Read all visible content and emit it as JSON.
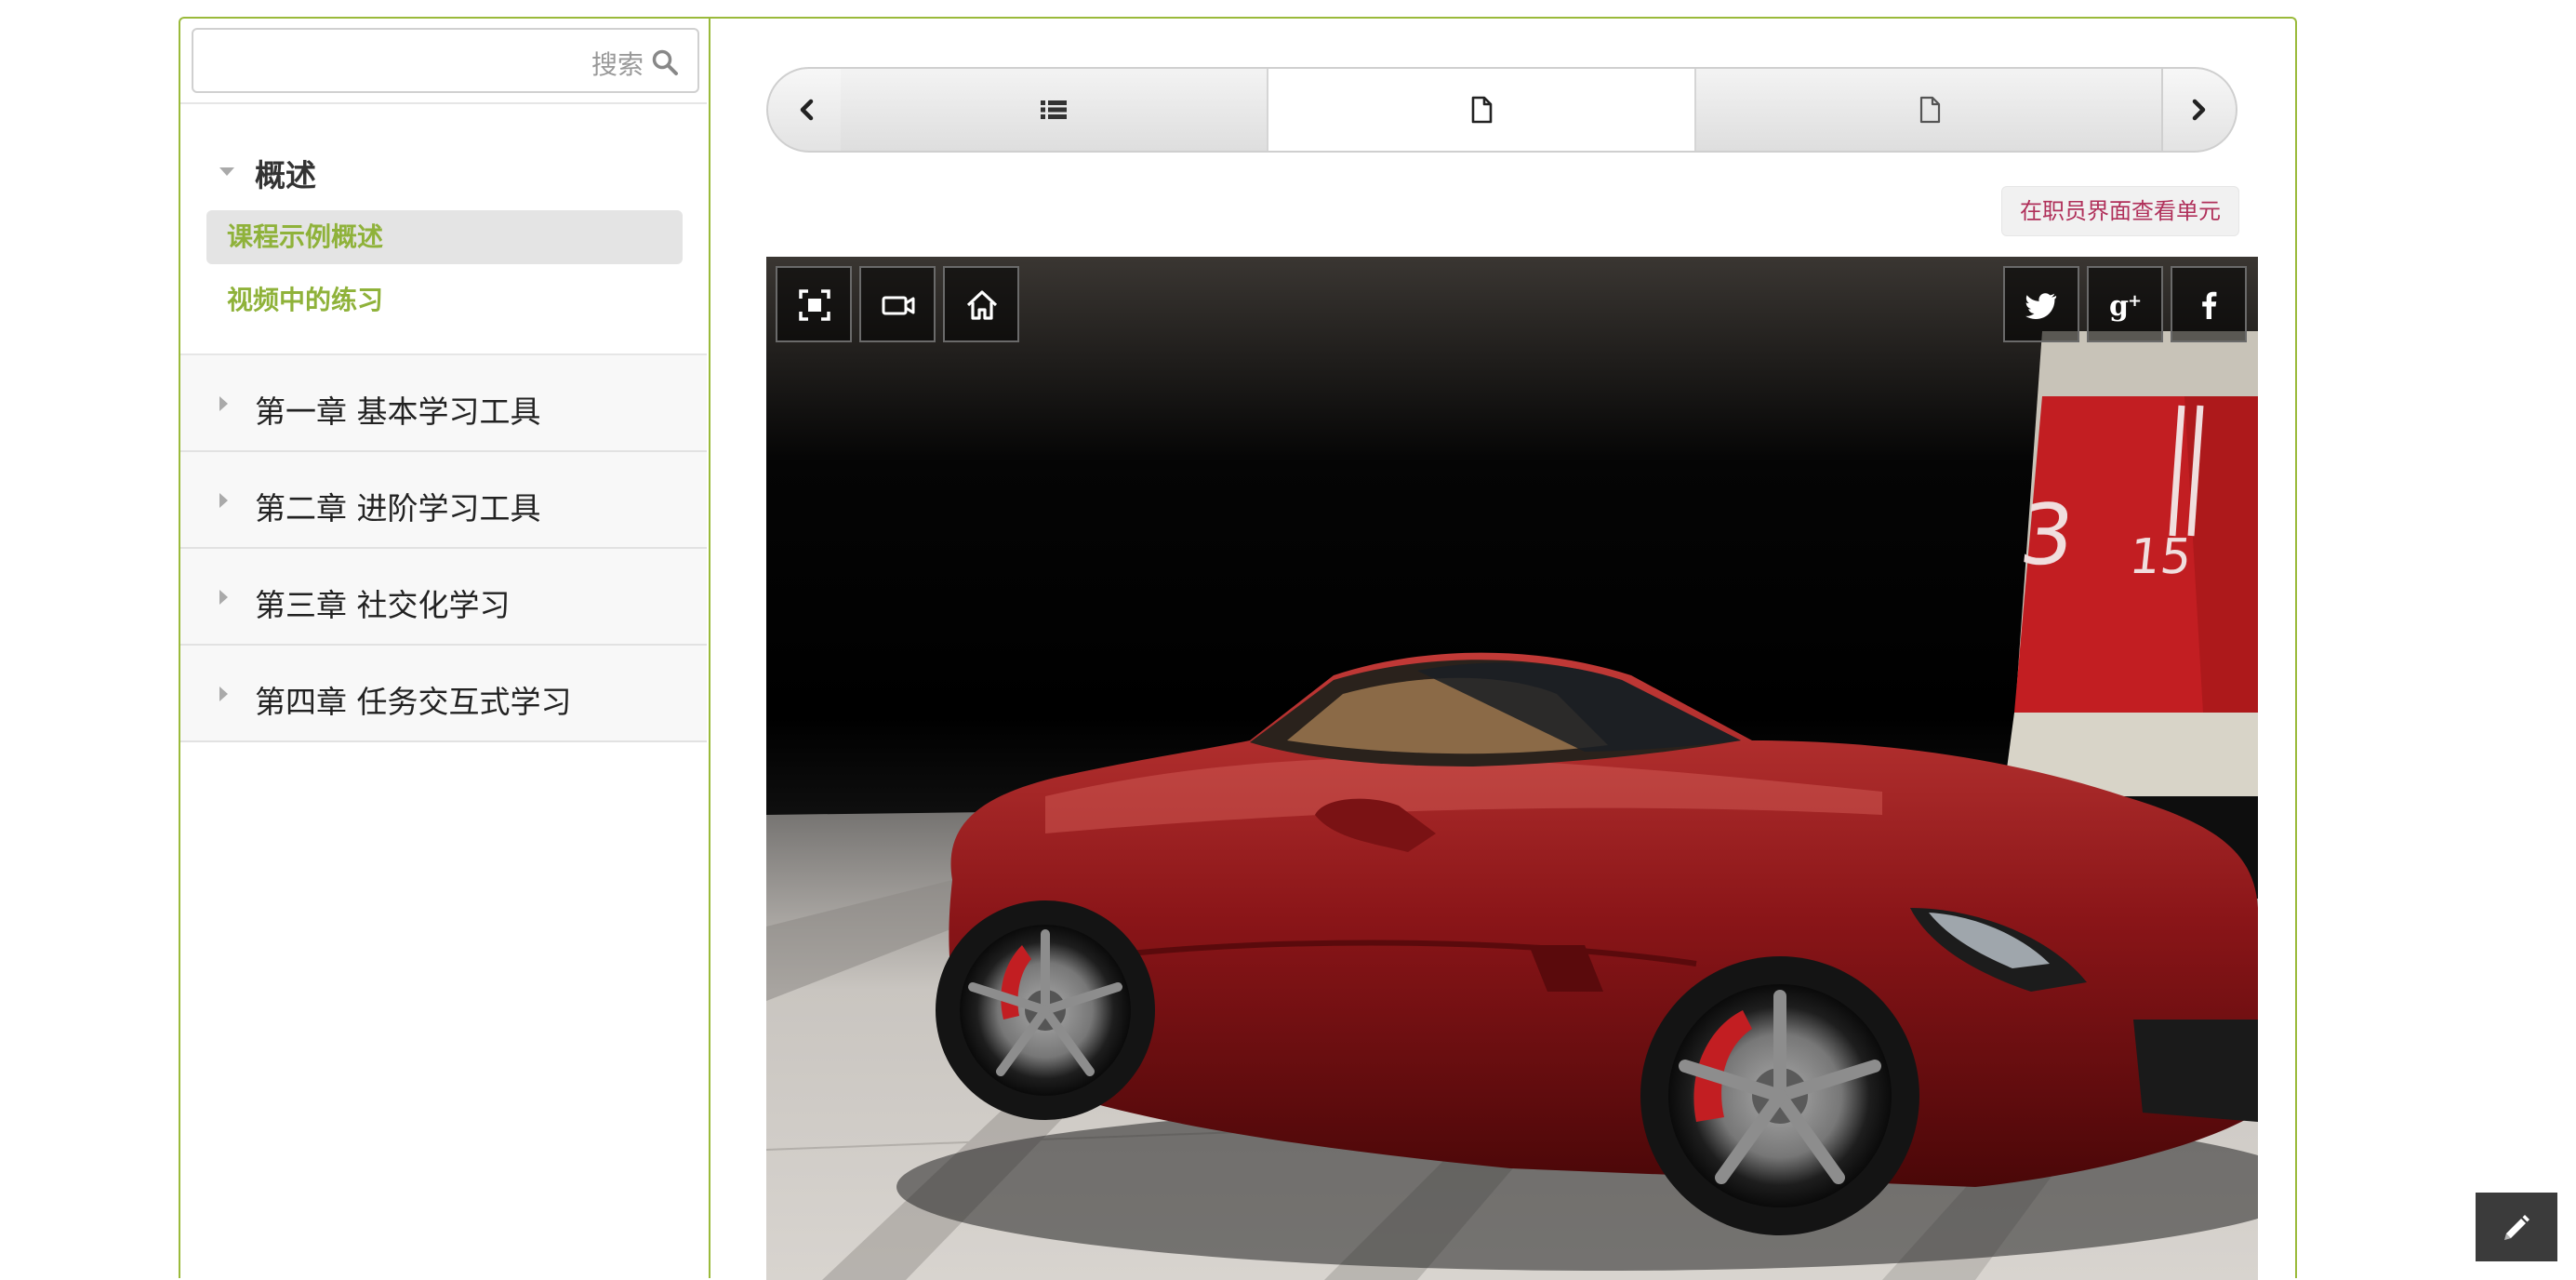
{
  "search": {
    "placeholder": "",
    "label": "搜索"
  },
  "sidebar": {
    "open_section": {
      "title": "概述",
      "items": [
        {
          "label": "课程示例概述",
          "active": true
        },
        {
          "label": "视频中的练习",
          "active": false
        }
      ]
    },
    "chapters": [
      {
        "label": "第一章 基本学习工具"
      },
      {
        "label": "第二章 进阶学习工具"
      },
      {
        "label": "第三章 社交化学习"
      },
      {
        "label": "第四章 任务交互式学习"
      }
    ]
  },
  "sequence_nav": {
    "prev_icon": "chevron-left-icon",
    "next_icon": "chevron-right-icon",
    "tabs": [
      {
        "icon": "list-icon",
        "active": false
      },
      {
        "icon": "document-icon",
        "active": true
      },
      {
        "icon": "document-icon",
        "active": false
      }
    ]
  },
  "staff_view_label": "在职员界面查看单元",
  "viewer": {
    "scene_labels": [
      "3",
      "15"
    ],
    "controls": [
      "fullscreen-icon",
      "camera-icon",
      "home-icon"
    ],
    "share": [
      "twitter-icon",
      "google-plus-icon",
      "facebook-icon"
    ]
  },
  "colors": {
    "accent_green": "#9aba3b",
    "link_green": "#8fb23a",
    "staff_link": "#b0305a",
    "car_red": "#8a1518"
  }
}
